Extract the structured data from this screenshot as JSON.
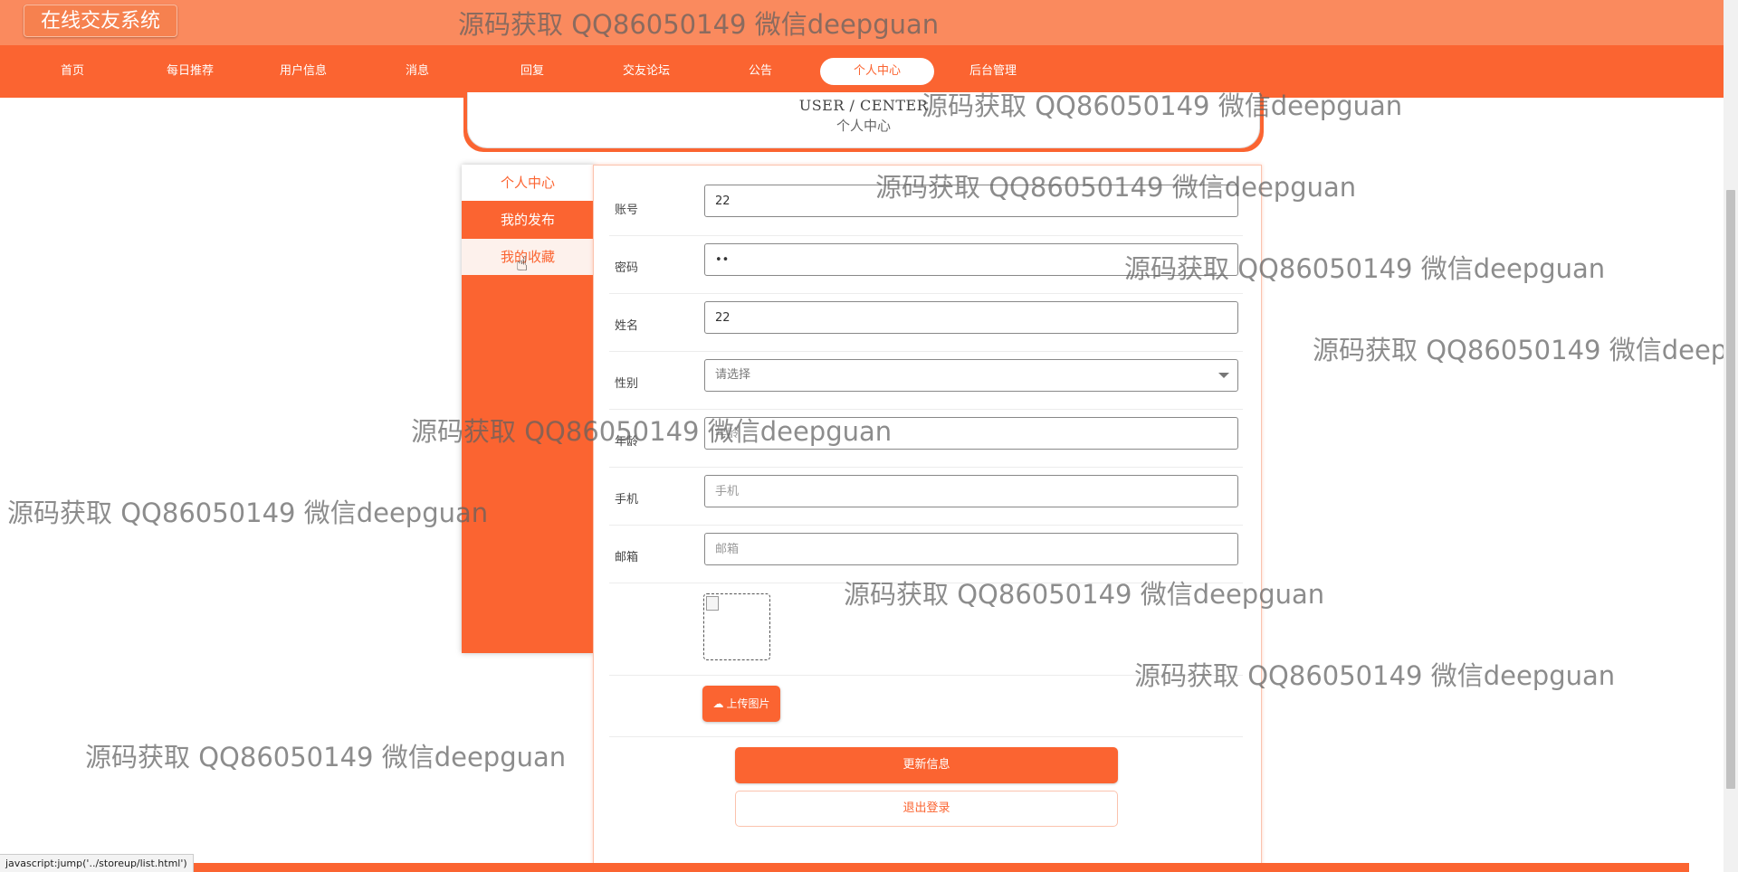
{
  "header": {
    "site_title": "在线交友系统"
  },
  "nav": {
    "items": [
      {
        "label": "首页"
      },
      {
        "label": "每日推荐"
      },
      {
        "label": "用户信息"
      },
      {
        "label": "消息"
      },
      {
        "label": "回复"
      },
      {
        "label": "交友论坛"
      },
      {
        "label": "公告"
      },
      {
        "label": "个人中心",
        "active": true
      },
      {
        "label": "后台管理"
      }
    ]
  },
  "banner": {
    "en": "USER / CENTER",
    "cn": "个人中心"
  },
  "side_menu": {
    "items": [
      {
        "label": "个人中心",
        "state": "active"
      },
      {
        "label": "我的发布",
        "state": "normal"
      },
      {
        "label": "我的收藏",
        "state": "hover"
      }
    ]
  },
  "form": {
    "account": {
      "label": "账号",
      "value": "22"
    },
    "password": {
      "label": "密码",
      "value": "22"
    },
    "name": {
      "label": "姓名",
      "value": "22"
    },
    "gender": {
      "label": "性别",
      "selected": "请选择"
    },
    "age": {
      "label": "年龄",
      "placeholder": "年龄"
    },
    "phone": {
      "label": "手机",
      "placeholder": "手机"
    },
    "email": {
      "label": "邮箱",
      "placeholder": "邮箱"
    },
    "upload_label": "上传图片",
    "update_label": "更新信息",
    "logout_label": "退出登录"
  },
  "status_bar": {
    "text": "javascript:jump('../storeup/list.html')"
  },
  "watermark": {
    "text": "源码获取 QQ86050149 微信deepguan"
  },
  "colors": {
    "primary": "#fb6431",
    "title_bar": "#fa8a5e"
  }
}
